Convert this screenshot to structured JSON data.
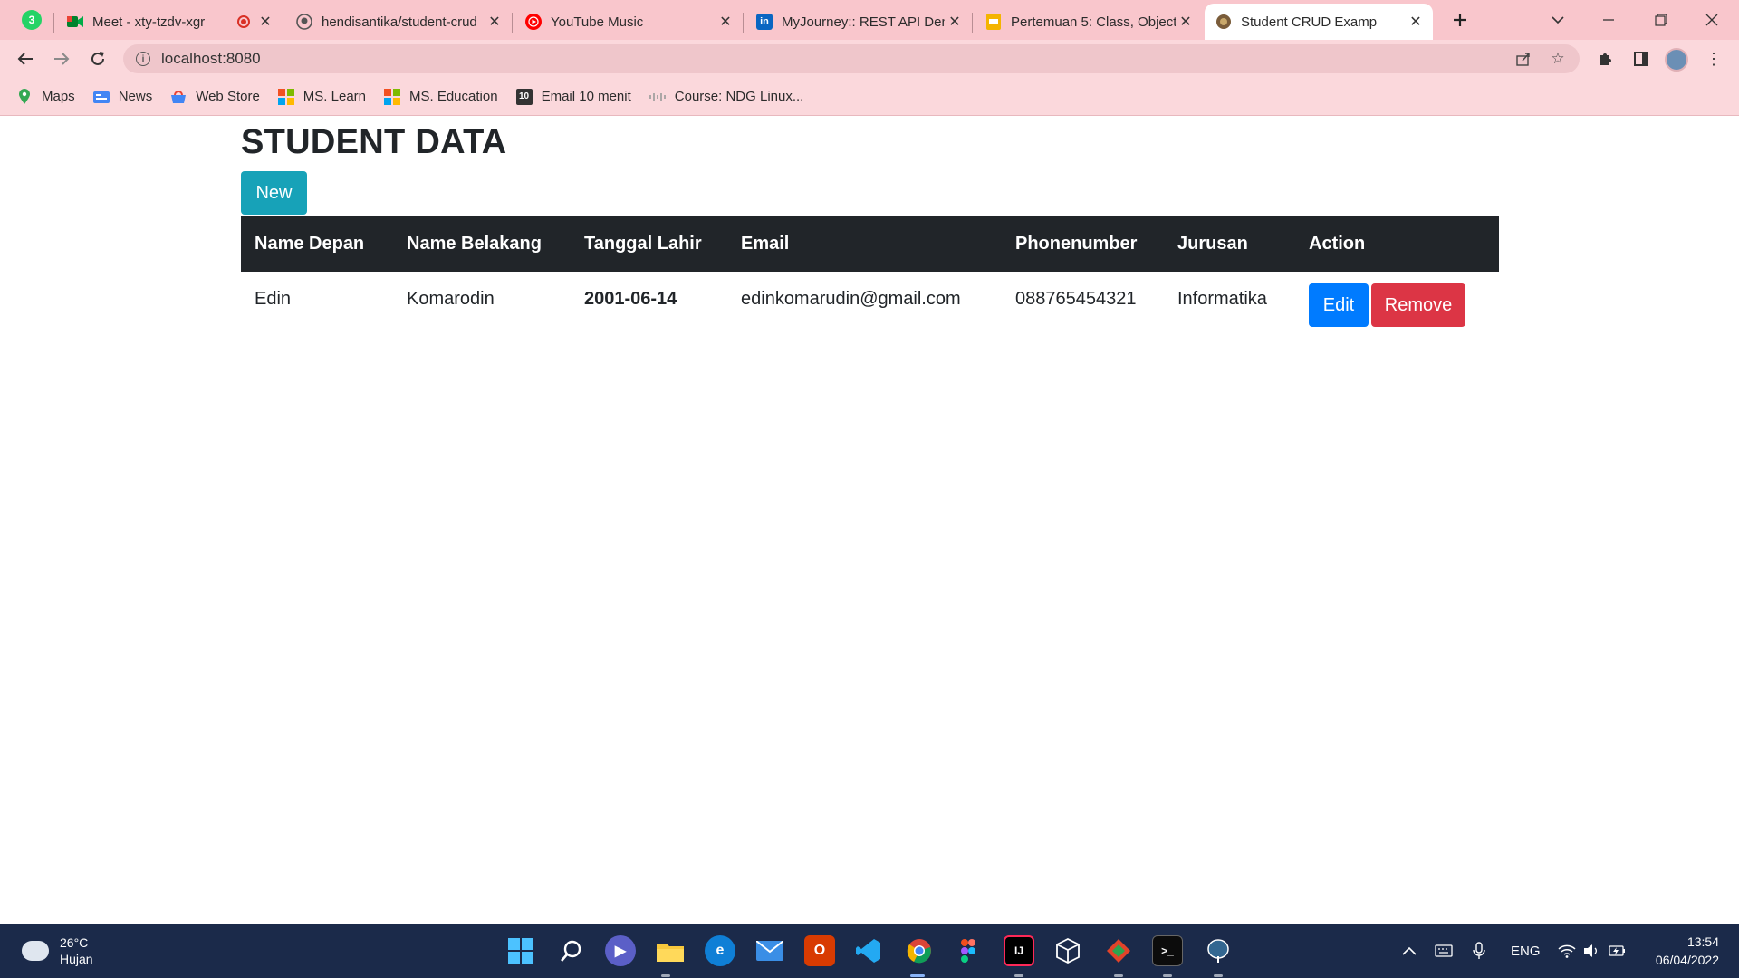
{
  "browser": {
    "pinned_tab": {
      "badge": "3",
      "icon": "whatsapp-icon"
    },
    "tabs": [
      {
        "title": "Meet - xty-tzdv-xgr",
        "icon": "google-meet-icon",
        "recording": true,
        "active": false
      },
      {
        "title": "hendisantika/student-crud",
        "icon": "github-icon",
        "active": false
      },
      {
        "title": "YouTube Music",
        "icon": "youtube-music-icon",
        "active": false
      },
      {
        "title": "MyJourney:: REST API Den",
        "icon": "linkedin-icon",
        "active": false
      },
      {
        "title": "Pertemuan 5: Class, Object",
        "icon": "google-slides-icon",
        "active": false
      },
      {
        "title": "Student CRUD Examp",
        "icon": "site-icon",
        "active": true
      }
    ],
    "address": "localhost:8080",
    "bookmarks": [
      {
        "label": "Maps",
        "icon": "maps-icon"
      },
      {
        "label": "News",
        "icon": "news-icon"
      },
      {
        "label": "Web Store",
        "icon": "web-store-icon"
      },
      {
        "label": "MS. Learn",
        "icon": "microsoft-icon"
      },
      {
        "label": "MS. Education",
        "icon": "microsoft-icon"
      },
      {
        "label": "Email 10 menit",
        "icon": "email-10-icon"
      },
      {
        "label": "Course: NDG Linux...",
        "icon": "cisco-icon"
      }
    ]
  },
  "page": {
    "title": "STUDENT DATA",
    "new_label": "New",
    "columns": [
      "Name Depan",
      "Name Belakang",
      "Tanggal Lahir",
      "Email",
      "Phonenumber",
      "Jurusan",
      "Action"
    ],
    "rows": [
      {
        "first_name": "Edin",
        "last_name": "Komarodin",
        "birth_date": "2001-06-14",
        "email": "edinkomarudin@gmail.com",
        "phone": "088765454321",
        "major": "Informatika",
        "edit_label": "Edit",
        "remove_label": "Remove"
      }
    ]
  },
  "taskbar": {
    "weather_temp": "26°C",
    "weather_desc": "Hujan",
    "language": "ENG",
    "time": "13:54",
    "date": "06/04/2022"
  },
  "colors": {
    "tabstrip": "#f9c6cc",
    "toolbar": "#fbd8dc",
    "btn_new": "#17a2b8",
    "btn_edit": "#007bff",
    "btn_remove": "#dc3545",
    "table_header": "#212529",
    "taskbar": "#1b2a4a"
  }
}
